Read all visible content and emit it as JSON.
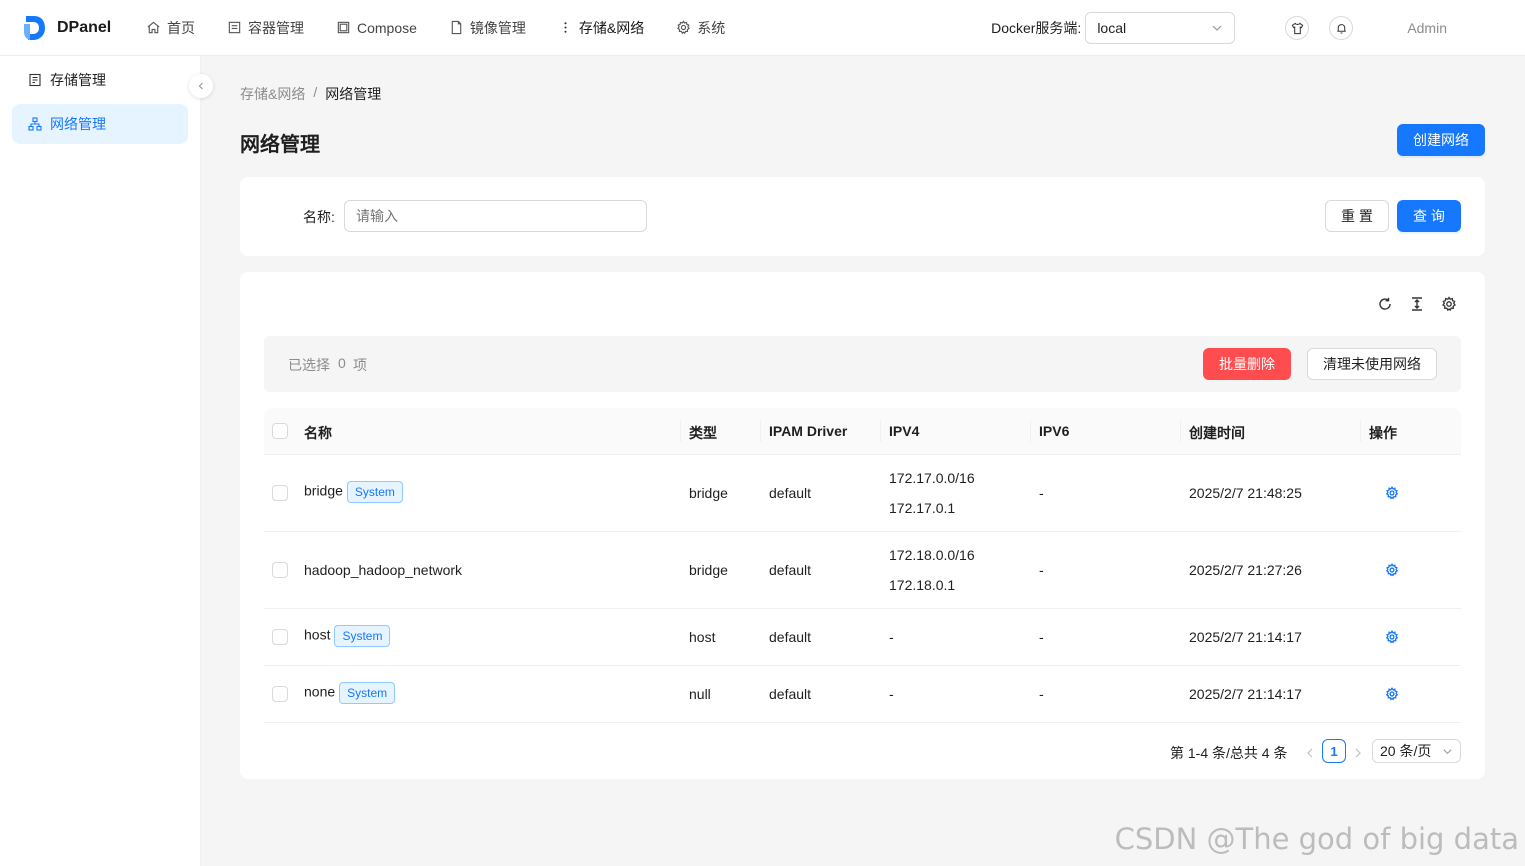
{
  "app": {
    "name": "DPanel"
  },
  "nav": {
    "items": [
      {
        "label": "首页",
        "icon": "home-icon"
      },
      {
        "label": "容器管理",
        "icon": "container-icon"
      },
      {
        "label": "Compose",
        "icon": "compose-icon"
      },
      {
        "label": "镜像管理",
        "icon": "file-icon"
      },
      {
        "label": "存储&网络",
        "icon": "more-vertical-icon"
      },
      {
        "label": "系统",
        "icon": "gear-icon"
      }
    ],
    "active": "存储&网络"
  },
  "header": {
    "docker_label": "Docker服务端:",
    "docker_value": "local",
    "user": "Admin"
  },
  "sidebar": {
    "items": [
      {
        "label": "存储管理",
        "icon": "storage-icon"
      },
      {
        "label": "网络管理",
        "icon": "network-icon"
      }
    ],
    "active": "网络管理"
  },
  "breadcrumb": {
    "parent": "存储&网络",
    "sep": "/",
    "current": "网络管理"
  },
  "page": {
    "title": "网络管理",
    "create_button": "创建网络"
  },
  "search": {
    "name_label": "名称:",
    "name_placeholder": "请输入",
    "reset_button": "重 置",
    "query_button": "查 询"
  },
  "toolbar": {
    "selected_prefix": "已选择",
    "selected_count": "0",
    "selected_suffix": "项",
    "batch_delete": "批量删除",
    "prune_button": "清理未使用网络"
  },
  "table": {
    "columns": [
      "名称",
      "类型",
      "IPAM Driver",
      "IPV4",
      "IPV6",
      "创建时间",
      "操作"
    ],
    "rows": [
      {
        "name": "bridge",
        "tag": "System",
        "type": "bridge",
        "ipam": "default",
        "ipv4": [
          "172.17.0.0/16",
          "172.17.0.1"
        ],
        "ipv6": "-",
        "created": "2025/2/7 21:48:25"
      },
      {
        "name": "hadoop_hadoop_network",
        "tag": "",
        "type": "bridge",
        "ipam": "default",
        "ipv4": [
          "172.18.0.0/16",
          "172.18.0.1"
        ],
        "ipv6": "-",
        "created": "2025/2/7 21:27:26"
      },
      {
        "name": "host",
        "tag": "System",
        "type": "host",
        "ipam": "default",
        "ipv4": [
          "-"
        ],
        "ipv6": "-",
        "created": "2025/2/7 21:14:17"
      },
      {
        "name": "none",
        "tag": "System",
        "type": "null",
        "ipam": "default",
        "ipv4": [
          "-"
        ],
        "ipv6": "-",
        "created": "2025/2/7 21:14:17"
      }
    ]
  },
  "pagination": {
    "summary": "第 1-4 条/总共 4 条",
    "current_page": "1",
    "page_size": "20 条/页"
  },
  "watermark": "CSDN @The god of big data",
  "colors": {
    "primary": "#1677ff",
    "danger": "#ff4d4f",
    "tag_bg": "#e6f4ff"
  }
}
